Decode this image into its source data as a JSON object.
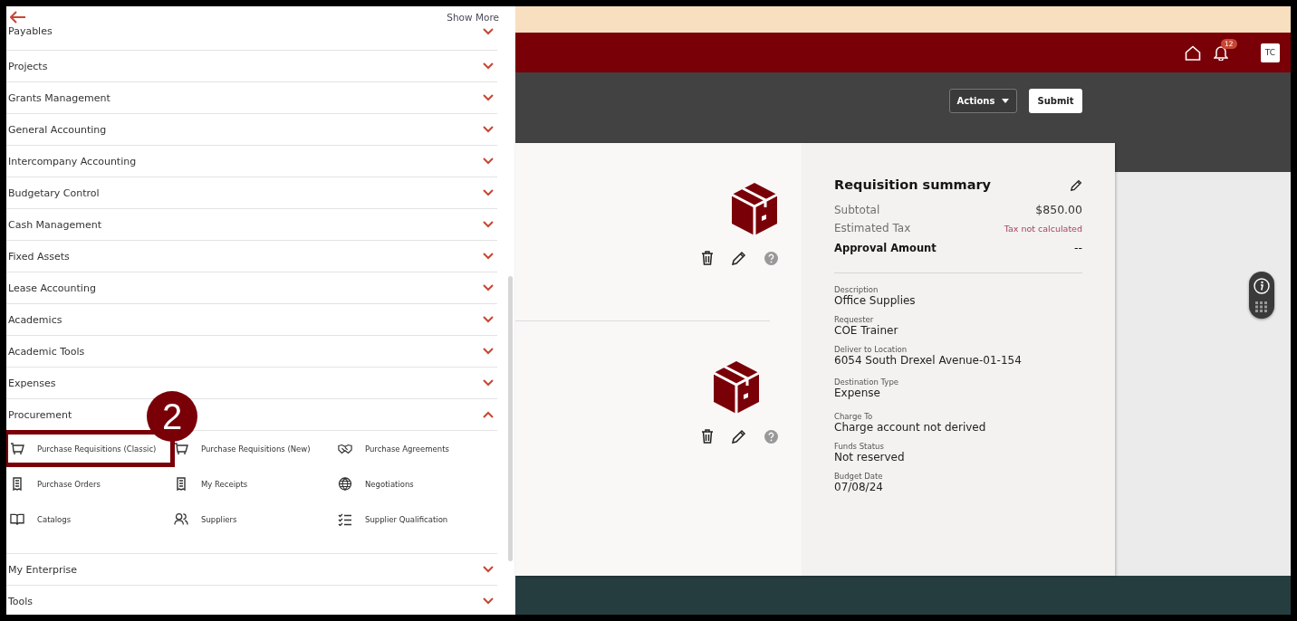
{
  "drawer": {
    "show_more": "Show More",
    "sections": [
      {
        "label": "Payables",
        "expanded": false
      },
      {
        "label": "Projects",
        "expanded": false
      },
      {
        "label": "Grants Management",
        "expanded": false
      },
      {
        "label": "General Accounting",
        "expanded": false
      },
      {
        "label": "Intercompany Accounting",
        "expanded": false
      },
      {
        "label": "Budgetary Control",
        "expanded": false
      },
      {
        "label": "Cash Management",
        "expanded": false
      },
      {
        "label": "Fixed Assets",
        "expanded": false
      },
      {
        "label": "Lease Accounting",
        "expanded": false
      },
      {
        "label": "Academics",
        "expanded": false
      },
      {
        "label": "Academic Tools",
        "expanded": false
      },
      {
        "label": "Expenses",
        "expanded": false
      },
      {
        "label": "Procurement",
        "expanded": true,
        "children": [
          {
            "label": "Purchase Requisitions (Classic)",
            "kind": "cart",
            "highlighted": true
          },
          {
            "label": "Purchase Requisitions (New)",
            "kind": "cart",
            "highlighted": false
          },
          {
            "label": "Purchase Agreements",
            "kind": "handshake",
            "highlighted": false
          },
          {
            "label": "Purchase Orders",
            "kind": "receipt",
            "highlighted": false
          },
          {
            "label": "My Receipts",
            "kind": "receipt",
            "highlighted": false
          },
          {
            "label": "Negotiations",
            "kind": "globe",
            "highlighted": false
          },
          {
            "label": "Catalogs",
            "kind": "book",
            "highlighted": false
          },
          {
            "label": "Suppliers",
            "kind": "people",
            "highlighted": false
          },
          {
            "label": "Supplier Qualification",
            "kind": "checklist",
            "highlighted": false
          }
        ]
      },
      {
        "label": "My Enterprise",
        "expanded": false
      },
      {
        "label": "Tools",
        "expanded": false
      }
    ]
  },
  "callout": {
    "number": "2"
  },
  "header": {
    "notification_count": "12",
    "avatar": "TC"
  },
  "toolbar": {
    "actions": "Actions",
    "submit": "Submit"
  },
  "summary": {
    "title": "Requisition summary",
    "totals": [
      {
        "label": "Subtotal",
        "value": "$850.00",
        "kind": "amount"
      },
      {
        "label": "Estimated Tax",
        "value": "Tax not calculated",
        "kind": "note"
      },
      {
        "label": "Approval Amount",
        "value": "--",
        "kind": "strong"
      }
    ],
    "fields": [
      {
        "label": "Description",
        "value": "Office Supplies"
      },
      {
        "label": "Requester",
        "value": "COE Trainer"
      },
      {
        "label": "Deliver to Location",
        "value": "6054 South Drexel Avenue-01-154"
      },
      {
        "label": "Destination Type",
        "value": "Expense"
      },
      {
        "label": "Charge To",
        "value": "Charge account not derived"
      },
      {
        "label": "Funds Status",
        "value": "Not reserved"
      },
      {
        "label": "Budget Date",
        "value": "07/08/24"
      }
    ]
  }
}
